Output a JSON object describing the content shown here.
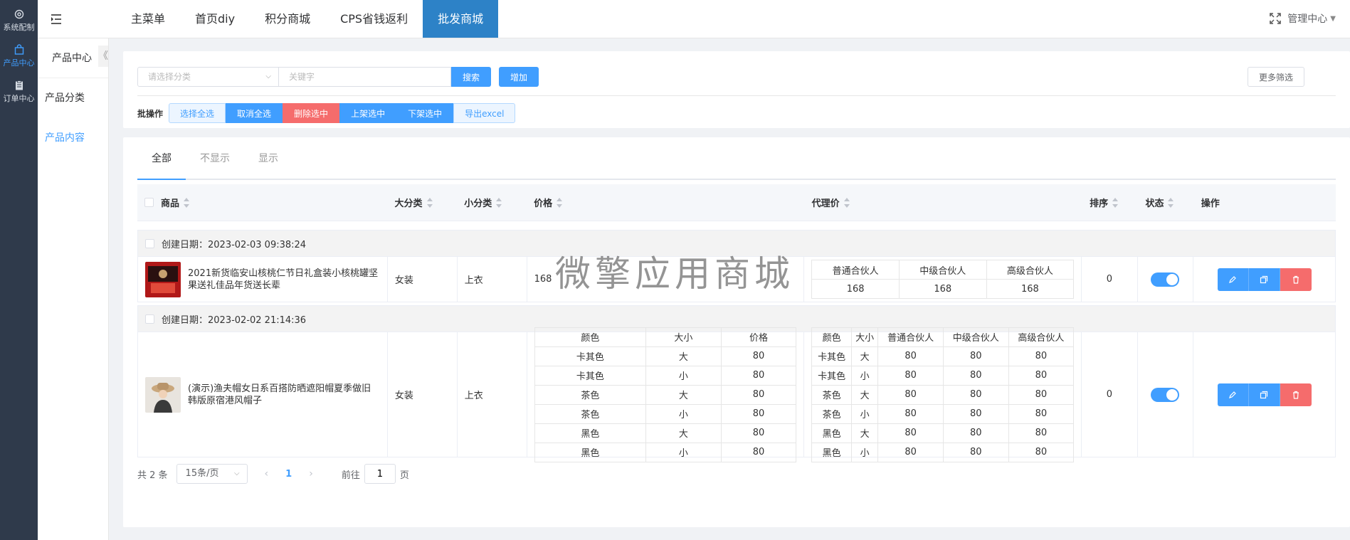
{
  "dark_nav": [
    {
      "label": "系统配制",
      "icon": "gear-icon"
    },
    {
      "label": "产品中心",
      "icon": "bag-icon"
    },
    {
      "label": "订单中心",
      "icon": "clipboard-icon"
    }
  ],
  "sub_nav": {
    "title": "产品中心",
    "collapse": "《",
    "items": [
      {
        "label": "产品分类"
      },
      {
        "label": "产品内容"
      }
    ]
  },
  "top_nav": {
    "tabs": [
      "主菜单",
      "首页diy",
      "积分商城",
      "CPS省钱返利",
      "批发商城"
    ],
    "right": "管理中心"
  },
  "filter": {
    "category_placeholder": "请选择分类",
    "keyword_placeholder": "关键字",
    "search": "搜索",
    "add": "增加",
    "more": "更多筛选",
    "batch_label": "批操作",
    "batch_buttons": [
      "选择全选",
      "取消全选",
      "删除选中",
      "上架选中",
      "下架选中",
      "导出excel"
    ]
  },
  "tabs": [
    "全部",
    "不显示",
    "显示"
  ],
  "table": {
    "headers": {
      "product": "商品",
      "big": "大分类",
      "small": "小分类",
      "price": "价格",
      "agent": "代理价",
      "sort": "排序",
      "state": "状态",
      "op": "操作"
    },
    "groups": [
      {
        "date": "创建日期：2023-02-03 09:38:24",
        "name": "2021新货临安山核桃仁节日礼盒装小核桃罐坚果送礼佳品年货送长辈",
        "big": "女装",
        "small": "上衣",
        "price": "168",
        "agent_headers": [
          "普通合伙人",
          "中级合伙人",
          "高级合伙人"
        ],
        "agent_rows": [
          [
            "168",
            "168",
            "168"
          ]
        ],
        "sort": "0"
      },
      {
        "date": "创建日期：2023-02-02 21:14:36",
        "name": "(演示)渔夫帽女日系百搭防晒遮阳帽夏季做旧韩版原宿港风帽子",
        "big": "女装",
        "small": "上衣",
        "price_headers": [
          "颜色",
          "大小",
          "价格"
        ],
        "price_rows": [
          [
            "卡其色",
            "大",
            "80"
          ],
          [
            "卡其色",
            "小",
            "80"
          ],
          [
            "茶色",
            "大",
            "80"
          ],
          [
            "茶色",
            "小",
            "80"
          ],
          [
            "黑色",
            "大",
            "80"
          ],
          [
            "黑色",
            "小",
            "80"
          ]
        ],
        "agent_headers": [
          "颜色",
          "大小",
          "普通合伙人",
          "中级合伙人",
          "高级合伙人"
        ],
        "agent_rows": [
          [
            "卡其色",
            "大",
            "80",
            "80",
            "80"
          ],
          [
            "卡其色",
            "小",
            "80",
            "80",
            "80"
          ],
          [
            "茶色",
            "大",
            "80",
            "80",
            "80"
          ],
          [
            "茶色",
            "小",
            "80",
            "80",
            "80"
          ],
          [
            "黑色",
            "大",
            "80",
            "80",
            "80"
          ],
          [
            "黑色",
            "小",
            "80",
            "80",
            "80"
          ]
        ],
        "sort": "0"
      }
    ]
  },
  "pager": {
    "total": "共 2 条",
    "size": "15条/页",
    "prev": "‹",
    "page": "1",
    "next": "›",
    "goto": "前往",
    "goto_value": "1",
    "page_unit": "页"
  },
  "watermark": "微擎应用商城",
  "colors": {
    "primary": "#409eff",
    "danger": "#f56c6c",
    "sidebar": "#2f3a4b",
    "active_tab": "#2d82c7"
  }
}
